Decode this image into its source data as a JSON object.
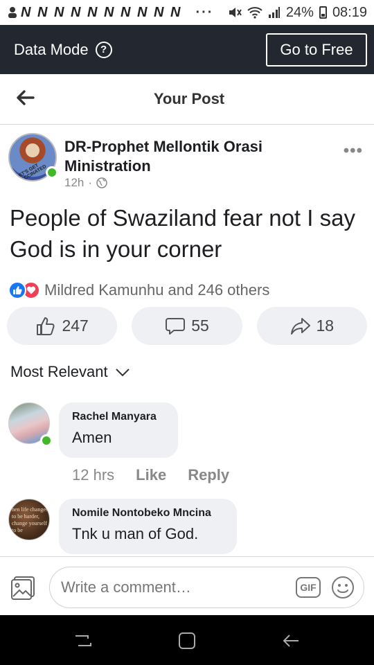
{
  "status": {
    "n_icons": "N N N N N N N N N N",
    "dots": "···",
    "battery": "24%",
    "time": "08:19"
  },
  "databar": {
    "title": "Data Mode",
    "help_glyph": "?",
    "free_button": "Go to Free"
  },
  "header": {
    "title": "Your Post"
  },
  "post": {
    "author": "DR-Prophet Mellontik Orasi Ministration",
    "time": "12h",
    "separator": "·",
    "avatar_ring_text": "LET'S GET VACCINATED",
    "text": "People of Swaziland fear not I say God is in your corner",
    "reactions_text": "Mildred Kamunhu and 246 others",
    "likes": "247",
    "comments": "55",
    "shares": "18",
    "icons": [
      "like-icon",
      "heart-icon",
      "comment-icon",
      "share-icon",
      "globe-icon",
      "more-icon"
    ]
  },
  "sort": {
    "label": "Most Relevant"
  },
  "comments": [
    {
      "name": "Rachel Manyara",
      "text": "Amen",
      "time": "12 hrs",
      "like": "Like",
      "reply": "Reply"
    },
    {
      "name": "Nomile Nontobeko Mncina",
      "text": "Tnk u man of God.",
      "avatar_text": "hen life changes to be harder, change yourself to be"
    }
  ],
  "composer": {
    "placeholder": "Write a comment…",
    "gif": "GIF"
  },
  "colors": {
    "databar_bg": "#23272f",
    "online": "#42b72a",
    "like_blue": "#1877f2",
    "love_red": "#f33e58",
    "pill_bg": "#eef0f3"
  }
}
